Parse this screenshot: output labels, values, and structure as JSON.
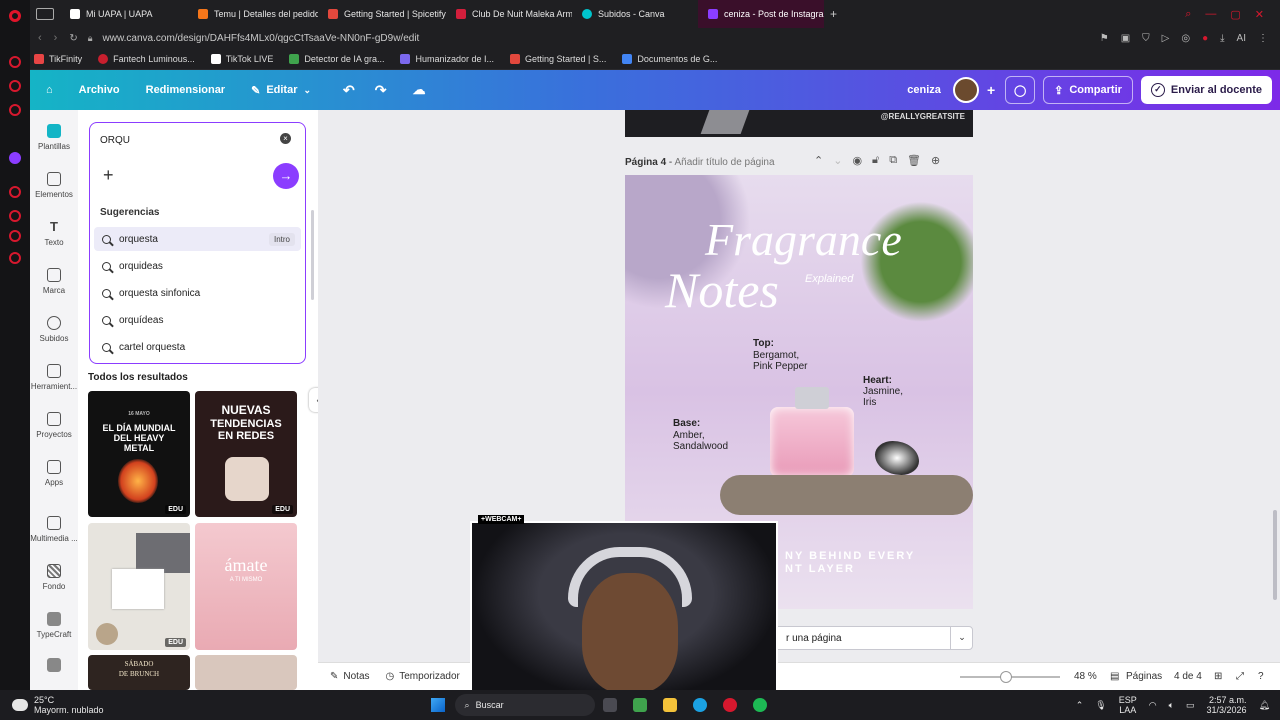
{
  "browser": {
    "tabs": [
      {
        "label": "Mi UAPA | UAPA",
        "color": "#ffffff",
        "active": false
      },
      {
        "label": "Temu | Detalles del pedido",
        "color": "#f5761a",
        "active": false
      },
      {
        "label": "Getting Started | Spicetify",
        "color": "#e2483d",
        "active": false
      },
      {
        "label": "Club De Nuit Maleka Arme",
        "color": "#d21f3c",
        "active": false
      },
      {
        "label": "Subidos - Canva",
        "color": "#00c4cc",
        "active": false
      },
      {
        "label": "ceniza - Post de Instagram",
        "color": "#8b3dff",
        "active": true
      }
    ],
    "new_tab": "+",
    "url": "www.canva.com/design/DAHFfs4MLx0/qgcCtTsaaVe-NN0nF-gD9w/edit",
    "bookmarks": [
      {
        "label": "TikFinity",
        "color": "#e84545"
      },
      {
        "label": "Fantech Luminous...",
        "color": "#c81f2e"
      },
      {
        "label": "TikTok LIVE",
        "color": "#ffffff"
      },
      {
        "label": "Detector de IA gra...",
        "color": "#3fa34d"
      },
      {
        "label": "Humanizador de I...",
        "color": "#7b68ee"
      },
      {
        "label": "Getting Started | S...",
        "color": "#e2483d"
      },
      {
        "label": "Documentos de G...",
        "color": "#4285f4"
      }
    ]
  },
  "header": {
    "archivo": "Archivo",
    "redimensionar": "Redimensionar",
    "editar": "Editar",
    "design_name": "ceniza",
    "compartir": "Compartir",
    "enviar": "Enviar al docente"
  },
  "leftnav": [
    {
      "label": "Plantillas",
      "icon": "templates-icon"
    },
    {
      "label": "Elementos",
      "icon": "elements-icon"
    },
    {
      "label": "Texto",
      "icon": "text-icon"
    },
    {
      "label": "Marca",
      "icon": "brand-icon"
    },
    {
      "label": "Subidos",
      "icon": "uploads-icon"
    },
    {
      "label": "Herramient...",
      "icon": "tools-icon"
    },
    {
      "label": "Proyectos",
      "icon": "projects-icon"
    },
    {
      "label": "Apps",
      "icon": "apps-icon"
    },
    {
      "label": "Multimedia ...",
      "icon": "media-icon"
    },
    {
      "label": "Fondo",
      "icon": "background-icon"
    },
    {
      "label": "TypeCraft",
      "icon": "typecraft-icon"
    }
  ],
  "search": {
    "value": "ORQU",
    "suggestions_title": "Sugerencias",
    "suggestions": [
      "orquesta",
      "orquideas",
      "orquesta sinfonica",
      "orquídeas",
      "cartel orquesta"
    ],
    "enter_hint": "Intro",
    "results_title": "Todos los resultados"
  },
  "templates": [
    {
      "line1": "16 MAYO",
      "line2": "EL DÍA MUNDIAL DEL HEAVY METAL",
      "badge": "EDU"
    },
    {
      "line1": "NUEVAS",
      "line2": "TENDENCIAS EN REDES",
      "badge": "EDU"
    },
    {
      "line1": "",
      "line2": "",
      "badge": "EDU"
    },
    {
      "line1": "ámate",
      "line2": "A TI MISMO",
      "badge": ""
    },
    {
      "line1": "SÁBADO",
      "line2": "DE BRUNCH",
      "badge": ""
    }
  ],
  "canvas": {
    "prev_handle": "@REALLYGREATSITE",
    "page_label": "Página 4",
    "page_title_placeholder": "Añadir título de página",
    "poster": {
      "title1": "Fragrance",
      "title2": "Notes",
      "explained": "Explained",
      "top_label": "Top:",
      "top_notes": [
        "Bergamot,",
        "Pink Pepper"
      ],
      "heart_label": "Heart:",
      "heart_notes": [
        "Jasmine,",
        "Iris"
      ],
      "base_label": "Base:",
      "base_notes": [
        "Amber,",
        "Sandalwood"
      ],
      "footer1": "NY BEHIND EVERY",
      "footer2": "NT LAYER"
    },
    "add_page": "r una página"
  },
  "bottombar": {
    "notas": "Notas",
    "temporizador": "Temporizador",
    "zoom": "48 %",
    "paginas": "Páginas",
    "page_count": "4 de 4"
  },
  "webcam": {
    "label": "+WEBCAM+"
  },
  "taskbar": {
    "weather_temp": "25°C",
    "weather_desc": "Mayorm. nublado",
    "search": "Buscar",
    "lang1": "ESP",
    "lang2": "LAA",
    "time": "2:57 a.m.",
    "date": "31/3/2026"
  }
}
